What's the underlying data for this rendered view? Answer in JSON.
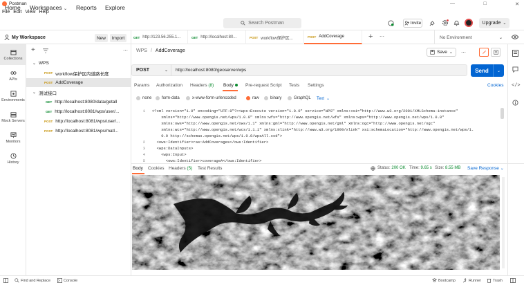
{
  "app": {
    "title": "Postman"
  },
  "menu": [
    "File",
    "Edit",
    "View",
    "Help"
  ],
  "header": {
    "home": "Home",
    "workspaces": "Workspaces",
    "reports": "Reports",
    "explore": "Explore",
    "search_placeholder": "Search Postman",
    "invite": "Invite",
    "upgrade": "Upgrade"
  },
  "workspace": {
    "name": "My Workspace",
    "new": "New",
    "import": "Import"
  },
  "rail": [
    {
      "label": "Collections",
      "icon": "collections-icon"
    },
    {
      "label": "APIs",
      "icon": "apis-icon"
    },
    {
      "label": "Environments",
      "icon": "environments-icon"
    },
    {
      "label": "Mock Servers",
      "icon": "mock-servers-icon"
    },
    {
      "label": "Monitors",
      "icon": "monitors-icon"
    },
    {
      "label": "History",
      "icon": "history-icon"
    }
  ],
  "tree": {
    "folder1": "WPS",
    "f1_items": [
      {
        "method": "POST",
        "label": "workflow保护区内道路长度"
      },
      {
        "method": "POST",
        "label": "AddCoverage"
      }
    ],
    "folder2": "测试接口",
    "f2_items": [
      {
        "method": "GET",
        "label": "http://localhost:8080/data/getall"
      },
      {
        "method": "GET",
        "label": "http://localhost:8081/wps/user/..."
      },
      {
        "method": "POST",
        "label": "http://localhost:8081/wps/user/..."
      },
      {
        "method": "POST",
        "label": "http://localhost:8081/wps/matl..."
      }
    ]
  },
  "tabs": [
    {
      "method": "GET",
      "label": "http://123.56.255.1..."
    },
    {
      "method": "GET",
      "label": "http://localhost:80..."
    },
    {
      "method": "POST",
      "label": "workflow保护区..."
    },
    {
      "method": "POST",
      "label": "AddCoverage"
    }
  ],
  "environment": "No Environment",
  "request": {
    "breadcrumb_root": "WPS",
    "breadcrumb_sep": "/",
    "breadcrumb_item": "AddCoverage",
    "save": "Save",
    "method": "POST",
    "url": "http://localhost:8080/geoserver/wps",
    "send": "Send"
  },
  "subtabs": {
    "params": "Params",
    "authorization": "Authorization",
    "headers": "Headers",
    "headers_count": "(8)",
    "body": "Body",
    "prerequest": "Pre-request Script",
    "tests": "Tests",
    "settings": "Settings",
    "cookies": "Cookies"
  },
  "body_options": [
    "none",
    "form-data",
    "x-www-form-urlencoded",
    "raw",
    "binary",
    "GraphQL"
  ],
  "body_format": "Text",
  "code_lines": [
    {
      "n": "1",
      "t": "<?xml version=\"1.0\" encoding=\"UTF-8\"?><wps:Execute version=\"1.0.0\" service=\"WPS\" xmlns:xsi=\"http://www.w3.org/2001/XMLSchema-instance\""
    },
    {
      "n": "",
      "t": "    xmlns=\"http://www.opengis.net/wps/1.0.0\" xmlns:wfs=\"http://www.opengis.net/wfs\" xmlns:wps=\"http://www.opengis.net/wps/1.0.0\""
    },
    {
      "n": "",
      "t": "    xmlns:ows=\"http://www.opengis.net/ows/1.1\" xmlns:gml=\"http://www.opengis.net/gml\" xmlns:ogc=\"http://www.opengis.net/ogc\""
    },
    {
      "n": "",
      "t": "    xmlns:wcs=\"http://www.opengis.net/wcs/1.1.1\" xmlns:xlink=\"http://www.w3.org/1999/xlink\" xsi:schemaLocation=\"http://www.opengis.net/wps/1."
    },
    {
      "n": "",
      "t": "    0.0 http://schemas.opengis.net/wps/1.0.0/wpsAll.xsd\">"
    },
    {
      "n": "2",
      "t": "  <ows:Identifier>ras:AddCoverages</ows:Identifier>"
    },
    {
      "n": "3",
      "t": "  <wps:DataInputs>"
    },
    {
      "n": "4",
      "t": "    <wps:Input>"
    },
    {
      "n": "5",
      "t": "      <ows:Identifier>coverageA</ows:Identifier>"
    }
  ],
  "response": {
    "body": "Body",
    "cookies": "Cookies",
    "headers": "Headers",
    "headers_count": "(5)",
    "test_results": "Test Results",
    "status_label": "Status:",
    "status": "200 OK",
    "time_label": "Time:",
    "time": "9.65 s",
    "size_label": "Size:",
    "size": "8.55 MB",
    "save_response": "Save Response"
  },
  "statusbar": {
    "find_replace": "Find and Replace",
    "console": "Console",
    "bootcamp": "Bootcamp",
    "runner": "Runner",
    "trash": "Trash"
  },
  "colors": {
    "accent": "#ff6c37",
    "send": "#0265d2",
    "get": "#0b8a2f",
    "post": "#c59106",
    "status_ok": "#0b8a2f"
  }
}
